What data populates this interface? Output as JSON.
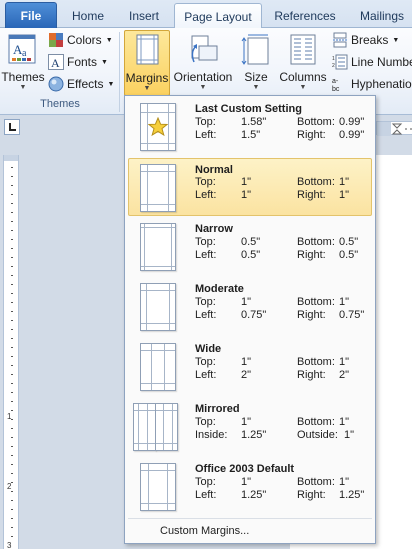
{
  "tabs": {
    "file": "File",
    "home": "Home",
    "insert": "Insert",
    "page_layout": "Page Layout",
    "references": "References",
    "mailings": "Mailings"
  },
  "ribbon": {
    "themes_group": {
      "themes_label": "Themes",
      "colors_label": "Colors",
      "fonts_label": "Fonts",
      "effects_label": "Effects",
      "group_label": "Themes"
    },
    "page_setup": {
      "margins_label": "Margins",
      "orientation_label": "Orientation",
      "size_label": "Size",
      "columns_label": "Columns",
      "breaks_label": "Breaks",
      "line_numbers_label": "Line Numbe",
      "hyphenation_label": "Hyphenation"
    },
    "icons": {
      "themes": "themes-icon",
      "colors": "colors-icon",
      "fonts": "fonts-icon",
      "effects": "effects-icon",
      "margins": "margins-icon",
      "orientation": "orientation-icon",
      "size": "size-icon",
      "columns": "columns-icon",
      "breaks": "breaks-icon",
      "line_numbers": "line-numbers-icon",
      "hyphenation": "hyphenation-icon"
    }
  },
  "margins_menu": {
    "items": [
      {
        "name": "Last Custom Setting",
        "k1": "Top:",
        "v1": "1.58\"",
        "k2": "Bottom:",
        "v2": "0.99\"",
        "k3": "Left:",
        "v3": "1.5\"",
        "k4": "Right:",
        "v4": "0.99\"",
        "icon": "star-icon"
      },
      {
        "name": "Normal",
        "k1": "Top:",
        "v1": "1\"",
        "k2": "Bottom:",
        "v2": "1\"",
        "k3": "Left:",
        "v3": "1\"",
        "k4": "Right:",
        "v4": "1\"",
        "icon": "page-margins-icon"
      },
      {
        "name": "Narrow",
        "k1": "Top:",
        "v1": "0.5\"",
        "k2": "Bottom:",
        "v2": "0.5\"",
        "k3": "Left:",
        "v3": "0.5\"",
        "k4": "Right:",
        "v4": "0.5\"",
        "icon": "page-margins-icon"
      },
      {
        "name": "Moderate",
        "k1": "Top:",
        "v1": "1\"",
        "k2": "Bottom:",
        "v2": "1\"",
        "k3": "Left:",
        "v3": "0.75\"",
        "k4": "Right:",
        "v4": "0.75\"",
        "icon": "page-margins-icon"
      },
      {
        "name": "Wide",
        "k1": "Top:",
        "v1": "1\"",
        "k2": "Bottom:",
        "v2": "1\"",
        "k3": "Left:",
        "v3": "2\"",
        "k4": "Right:",
        "v4": "2\"",
        "icon": "page-margins-icon"
      },
      {
        "name": "Mirrored",
        "k1": "Top:",
        "v1": "1\"",
        "k2": "Bottom:",
        "v2": "1\"",
        "k3": "Inside:",
        "v3": "1.25\"",
        "k4": "Outside:",
        "v4": "1\"",
        "icon": "mirrored-pages-icon"
      },
      {
        "name": "Office 2003 Default",
        "k1": "Top:",
        "v1": "1\"",
        "k2": "Bottom:",
        "v2": "1\"",
        "k3": "Left:",
        "v3": "1.25\"",
        "k4": "Right:",
        "v4": "1.25\"",
        "icon": "page-margins-icon"
      }
    ],
    "selected_index": 1,
    "custom_margins_label": "Custom Margins..."
  },
  "ruler": {
    "numbers": [
      "1",
      "2",
      "3"
    ]
  },
  "colors": {
    "file_tab": "#2a66b7",
    "highlight": "#fbe3a1",
    "accent_text": "#1e395b"
  }
}
